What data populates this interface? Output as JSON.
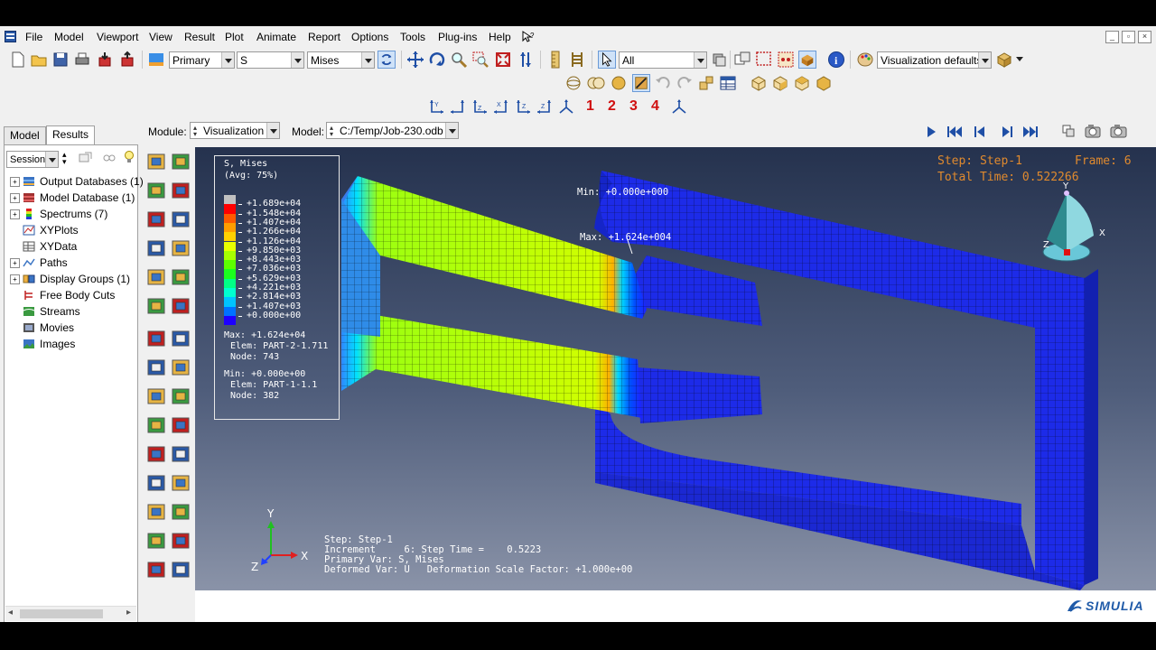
{
  "menu": [
    "File",
    "Model",
    "Viewport",
    "View",
    "Result",
    "Plot",
    "Animate",
    "Report",
    "Options",
    "Tools",
    "Plug-ins",
    "Help"
  ],
  "toolbar": {
    "primary_combo": "Primary",
    "variable_combo": "S",
    "invariant_combo": "Mises",
    "display_group_combo": "All",
    "visualization_combo": "Visualization defaults",
    "view_numbers": [
      "1",
      "2",
      "3",
      "4"
    ]
  },
  "context": {
    "module_label": "Module:",
    "module_value": "Visualization",
    "model_label": "Model:",
    "model_value": "C:/Temp/Job-230.odb"
  },
  "tabs": [
    "Model",
    "Results"
  ],
  "tree": {
    "session_combo": "Session D",
    "items": [
      {
        "label": "Output Databases (1)",
        "expandable": true
      },
      {
        "label": "Model Database (1)",
        "expandable": true
      },
      {
        "label": "Spectrums (7)",
        "expandable": true
      },
      {
        "label": "XYPlots",
        "expandable": false
      },
      {
        "label": "XYData",
        "expandable": false
      },
      {
        "label": "Paths",
        "expandable": true
      },
      {
        "label": "Display Groups (1)",
        "expandable": true
      },
      {
        "label": "Free Body Cuts",
        "expandable": false
      },
      {
        "label": "Streams",
        "expandable": false
      },
      {
        "label": "Movies",
        "expandable": false
      },
      {
        "label": "Images",
        "expandable": false
      }
    ]
  },
  "legend": {
    "title": "S, Mises",
    "subtitle": "(Avg: 75%)",
    "levels": [
      "+1.689e+04",
      "+1.548e+04",
      "+1.407e+04",
      "+1.266e+04",
      "+1.126e+04",
      "+9.850e+03",
      "+8.443e+03",
      "+7.036e+03",
      "+5.629e+03",
      "+4.221e+03",
      "+2.814e+03",
      "+1.407e+03",
      "+0.000e+00"
    ],
    "colors": [
      "#c0c0c0",
      "#ff0000",
      "#ff5a00",
      "#ff9d00",
      "#ffd000",
      "#e8ff00",
      "#a6ff00",
      "#5cff00",
      "#1bff1e",
      "#00ff86",
      "#00ffd0",
      "#00c4ff",
      "#0072ff",
      "#1e00ff"
    ],
    "max_line": "Max: +1.624e+04",
    "max_elem": "Elem: PART-2-1.711",
    "max_node": "Node: 743",
    "min_line": "Min: +0.000e+00",
    "min_elem": "Elem: PART-1-1.1",
    "min_node": "Node: 382"
  },
  "step_header": {
    "step": "Step: Step-1",
    "frame": "Frame: 6",
    "total_time": "Total Time: 0.522266"
  },
  "annotations": {
    "min_probe": "Min: +0.000e+000",
    "max_probe": "Max: +1.624e+004"
  },
  "triad": {
    "y": "Y",
    "x": "X",
    "z": "Z"
  },
  "info": {
    "line1": "Step: Step-1",
    "line2": "Increment     6: Step Time =    0.5223",
    "line3": "Primary Var: S, Mises",
    "line4": "Deformed Var: U   Deformation Scale Factor: +1.000e+00"
  },
  "brand": "SIMULIA"
}
